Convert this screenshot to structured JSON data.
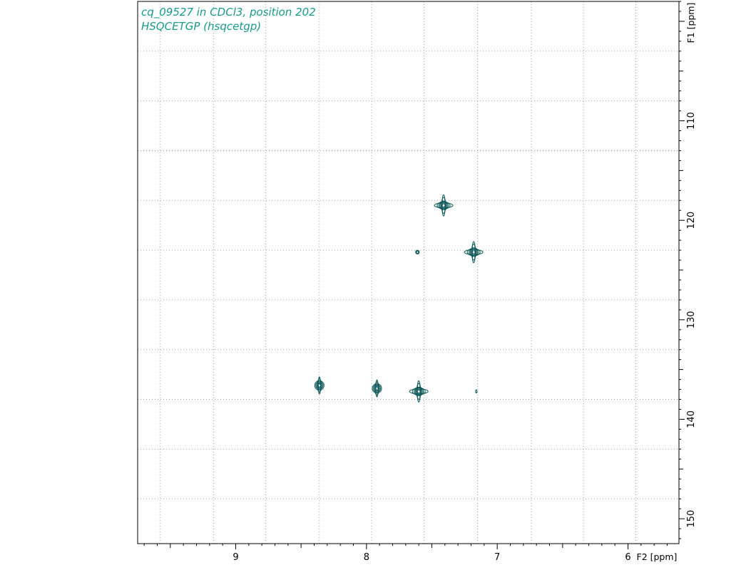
{
  "colors": {
    "contour": "#0f5a5a",
    "title": "#17998a",
    "grid": "#a0a0a0",
    "frame": "#000000"
  },
  "chart_data": {
    "type": "contour-2d-nmr",
    "title_lines": [
      "cq_09527 in CDCl3, position 202",
      "HSQCETGP (hsqcetgp)"
    ],
    "x_axis": {
      "label": "F2 [ppm]",
      "range": [
        9.75,
        5.61
      ],
      "reversed": true,
      "ticks": [
        {
          "value": 9,
          "label": "9"
        },
        {
          "value": 8,
          "label": "8"
        },
        {
          "value": 7,
          "label": "7"
        },
        {
          "value": 6,
          "label": "6"
        }
      ],
      "grid": [
        9.58,
        9.17,
        8.77,
        8.36,
        7.96,
        7.56,
        7.15,
        6.74,
        6.34,
        5.94
      ]
    },
    "y_axis": {
      "label": "F1 [ppm]",
      "range": [
        98.0,
        152.5
      ],
      "reversed": true,
      "ticks": [
        {
          "value": 110,
          "label": "110"
        },
        {
          "value": 120,
          "label": "120"
        },
        {
          "value": 130,
          "label": "130"
        },
        {
          "value": 140,
          "label": "140"
        },
        {
          "value": 150,
          "label": "150"
        }
      ],
      "grid": [
        103,
        108,
        113,
        118,
        123,
        128,
        133,
        138,
        143,
        148
      ]
    },
    "peaks": [
      {
        "x": 7.41,
        "y": 118.5,
        "intensity": "strong"
      },
      {
        "x": 7.18,
        "y": 123.2,
        "intensity": "strong"
      },
      {
        "x": 7.61,
        "y": 123.2,
        "intensity": "weak"
      },
      {
        "x": 8.36,
        "y": 136.6,
        "intensity": "medium"
      },
      {
        "x": 7.92,
        "y": 136.9,
        "intensity": "medium"
      },
      {
        "x": 7.6,
        "y": 137.2,
        "intensity": "strong"
      },
      {
        "x": 7.16,
        "y": 137.2,
        "intensity": "trace"
      }
    ],
    "grid": true
  }
}
